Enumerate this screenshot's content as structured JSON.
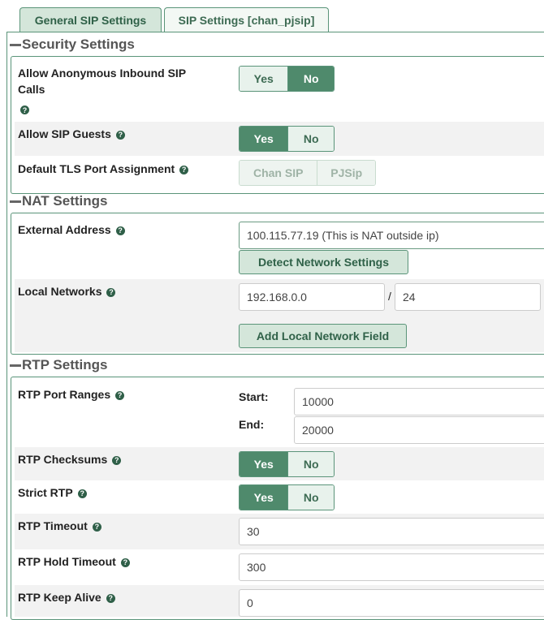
{
  "tabs": [
    {
      "label": "General SIP Settings",
      "active": true
    },
    {
      "label": "SIP Settings [chan_pjsip]",
      "active": false
    }
  ],
  "security": {
    "title": "Security Settings",
    "anon_label": "Allow Anonymous Inbound SIP Calls",
    "anon_yes": "Yes",
    "anon_no": "No",
    "anon_selected": "No",
    "guests_label": "Allow SIP Guests",
    "guests_yes": "Yes",
    "guests_no": "No",
    "guests_selected": "Yes",
    "tls_label": "Default TLS Port Assignment",
    "tls_opt1": "Chan SIP",
    "tls_opt2": "PJSip"
  },
  "nat": {
    "title": "NAT Settings",
    "external_label": "External Address",
    "external_value": "100.115.77.19 (This is NAT outside ip)",
    "detect_button": "Detect Network Settings",
    "local_label": "Local Networks",
    "local_ip": "192.168.0.0",
    "slash": "/",
    "local_mask": "24",
    "add_button": "Add Local Network Field"
  },
  "rtp": {
    "title": "RTP Settings",
    "ports_label": "RTP Port Ranges",
    "start_label": "Start:",
    "start_value": "10000",
    "end_label": "End:",
    "end_value": "20000",
    "checksums_label": "RTP Checksums",
    "checksums_yes": "Yes",
    "checksums_no": "No",
    "checksums_selected": "Yes",
    "strict_label": "Strict RTP",
    "strict_yes": "Yes",
    "strict_no": "No",
    "strict_selected": "Yes",
    "timeout_label": "RTP Timeout",
    "timeout_value": "30",
    "hold_label": "RTP Hold Timeout",
    "hold_value": "300",
    "keepalive_label": "RTP Keep Alive",
    "keepalive_value": "0"
  },
  "colors": {
    "accent": "#4f8a6c",
    "border": "#5a9479",
    "tab_bg": "#d4e6da"
  }
}
